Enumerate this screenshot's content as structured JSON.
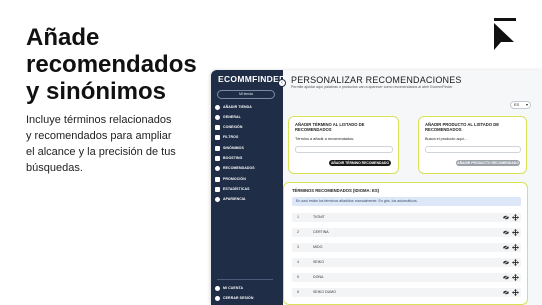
{
  "marketing": {
    "headline": "Añade\nrecomendados\ny sinónimos",
    "tagline": "Incluye términos relacionados\ny recomendados para ampliar\nel alcance y la precisión de tus\nbúsquedas."
  },
  "app": {
    "sidebar": {
      "title": "ECOMMFINDER",
      "user_button": "Mi tienda",
      "items": [
        {
          "label": "AÑADIR TIENDA",
          "icon": "plus-icon"
        },
        {
          "label": "GENERAL",
          "icon": "gear-icon"
        },
        {
          "label": "CONEXIÓN",
          "icon": "link-icon"
        },
        {
          "label": "FILTROS",
          "icon": "filter-icon"
        },
        {
          "label": "SINÓNIMOS",
          "icon": "list-icon"
        },
        {
          "label": "BOOSTING",
          "icon": "boost-icon"
        },
        {
          "label": "RECOMENDADOS",
          "icon": "star-icon"
        },
        {
          "label": "PROMOCIÓN",
          "icon": "tag-icon"
        },
        {
          "label": "ESTADÍSTICAS",
          "icon": "chart-icon"
        },
        {
          "label": "APARIENCIA",
          "icon": "palette-icon"
        }
      ],
      "footer_items": [
        {
          "label": "MI CUENTA",
          "icon": "user-icon"
        },
        {
          "label": "CERRAR SESIÓN",
          "icon": "logout-icon"
        }
      ]
    },
    "header": {
      "title": "PERSONALIZAR RECOMENDACIONES",
      "subtitle": "Permite ajustar aquí palabras o productos van a aparecer como recomendados al abrir EcommFinder",
      "language": "ES"
    },
    "add_term_card": {
      "title": "AÑADIR TÉRMINO AL LISTADO DE RECOMENDADOS",
      "label": "Término a añadir a recomendados:",
      "input_value": "",
      "button": "AÑADIR TÉRMINO RECOMENDADO"
    },
    "add_product_card": {
      "title": "AÑADIR PRODUCTO AL LISTADO DE RECOMENDADOS",
      "label": "Busca el producto aquí...",
      "input_value": "",
      "button": "AÑADIR PRODUCTO RECOMENDADO"
    },
    "terms": {
      "title": "TÉRMINOS RECOMENDADOS (IDIOMA: ES)",
      "info": "En azul están los términos añadidos manualmente. En gris, los automáticos.",
      "rows": [
        {
          "num": "1",
          "text": "TIGNIT"
        },
        {
          "num": "2",
          "text": "CERTINA"
        },
        {
          "num": "3",
          "text": "MIDO"
        },
        {
          "num": "4",
          "text": "SEIKO"
        },
        {
          "num": "5",
          "text": "DONA"
        },
        {
          "num": "6",
          "text": "SEIKO DUMO"
        }
      ]
    }
  },
  "colors": {
    "sidebar_bg": "#1f2d47",
    "card_border": "#d9e257",
    "button_dark": "#1a1a1a",
    "button_grey": "#9aa0a8",
    "info_bg": "#dde7f7"
  }
}
